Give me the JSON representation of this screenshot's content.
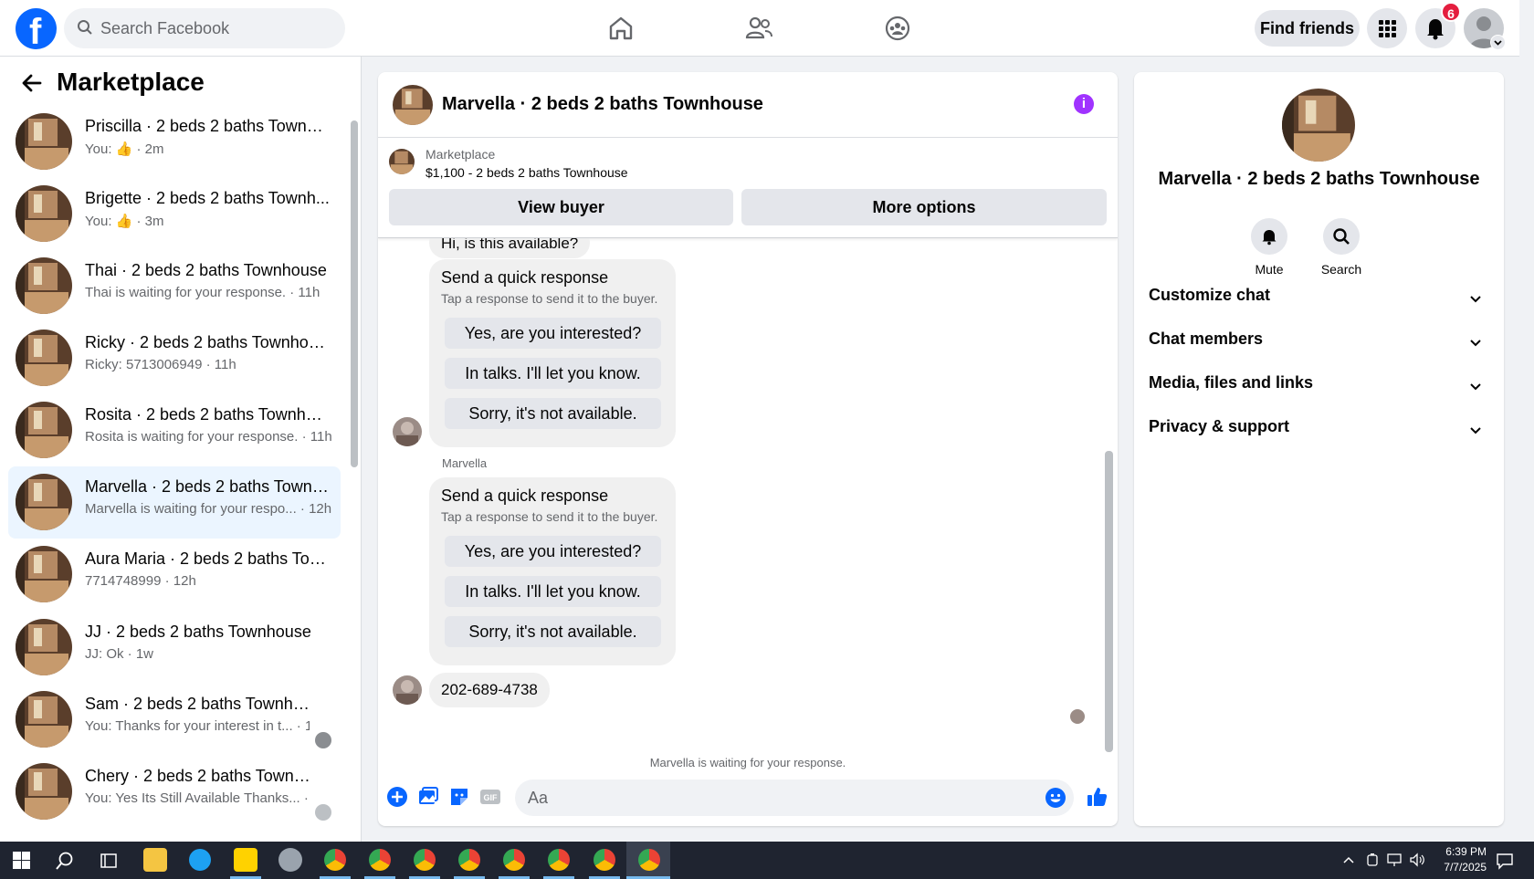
{
  "topbar": {
    "logo_letter": "f",
    "search_placeholder": "Search Facebook",
    "find_friends_label": "Find friends",
    "notification_count": "6"
  },
  "sidebar": {
    "title": "Marketplace",
    "conversations": [
      {
        "name": "Priscilla · 2 beds 2 baths Townho...",
        "sub": "You: 👍 · 2m",
        "active": false
      },
      {
        "name": "Brigette · 2 beds 2 baths Townh...",
        "sub": "You: 👍 · 3m",
        "active": false
      },
      {
        "name": "Thai · 2 beds 2 baths Townhouse",
        "sub": "Thai is waiting for your response. · 11h",
        "active": false
      },
      {
        "name": "Ricky · 2 beds 2 baths Townhouse",
        "sub": "Ricky: 5713006949 · 11h",
        "active": false
      },
      {
        "name": "Rosita · 2 beds 2 baths Townhouse",
        "sub": "Rosita is waiting for your response. · 11h",
        "active": false
      },
      {
        "name": "Marvella · 2 beds 2 baths Townh...",
        "sub": "Marvella is waiting for your respo...  · 12h",
        "active": true
      },
      {
        "name": "Aura Maria · 2 beds 2 baths Tow...",
        "sub": "7714748999 · 12h",
        "active": false
      },
      {
        "name": "JJ · 2 beds 2 baths Townhouse",
        "sub": "JJ: Ok · 1w",
        "active": false
      },
      {
        "name": "Sam · 2 beds 2 baths Townho...",
        "sub": "You: Thanks for your interest in t... · 1w",
        "active": false
      },
      {
        "name": "Chery · 2 beds 2 baths Townh...",
        "sub": "You: Yes Its Still Available Thanks... · 1w",
        "active": false
      }
    ]
  },
  "chat": {
    "title": "Marvella · 2 beds 2 baths Townhouse",
    "marketplace_label": "Marketplace",
    "listing": "$1,100 - 2 beds 2 baths Townhouse",
    "view_buyer": "View buyer",
    "more_options": "More options",
    "partial_message": "Hi, is this available?",
    "sender_name": "Marvella",
    "quick_response": {
      "title": "Send a quick response",
      "subtitle": "Tap a response to send it to the buyer.",
      "options": [
        "Yes, are you interested?",
        "In talks. I'll let you know.",
        "Sorry, it's not available."
      ]
    },
    "phone_message": "202-689-4738",
    "waiting_text": "Marvella is waiting for your response.",
    "composer_placeholder": "Aa",
    "gif_label": "GIF"
  },
  "details": {
    "title": "Marvella · 2 beds 2 baths Townhouse",
    "mute_label": "Mute",
    "search_label": "Search",
    "sections": [
      "Customize chat",
      "Chat members",
      "Media, files and links",
      "Privacy & support"
    ]
  },
  "taskbar": {
    "time": "6:39 PM",
    "date": "7/7/2025"
  },
  "colors": {
    "brand": "#0866ff",
    "info": "#a033ff",
    "active_row": "#ebf5ff"
  }
}
